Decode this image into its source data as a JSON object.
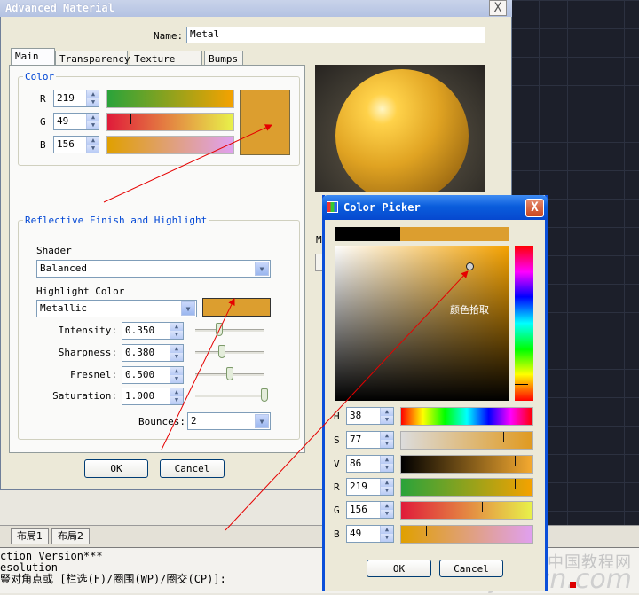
{
  "advanced_material": {
    "title": "Advanced Material",
    "close_glyph": "X",
    "name_label": "Name:",
    "name_value": "Metal",
    "tabs": [
      "Main",
      "Transparency",
      "Texture Maps",
      "Bumps"
    ],
    "color_group": "Color",
    "color_channels": [
      {
        "label": "R",
        "value": "219",
        "level": 0.86,
        "gradient": [
          "#2aa33a",
          "#f5a200"
        ]
      },
      {
        "label": "G",
        "value": "49",
        "level": 0.19,
        "gradient": [
          "#e01b3a",
          "#e8f24a"
        ]
      },
      {
        "label": "B",
        "value": "156",
        "level": 0.61,
        "gradient": [
          "#e0a000",
          "#e0a0f0"
        ]
      }
    ],
    "color_swatch": "#dc9e2f",
    "reflective_group": "Reflective Finish and Highlight",
    "shader_label": "Shader",
    "shader_value": "Balanced",
    "highlight_color_label": "Highlight Color",
    "highlight_color_value": "Metallic",
    "highlight_swatch": "#dc9e2f",
    "params": [
      {
        "label": "Intensity:",
        "value": "0.350",
        "level": 0.35
      },
      {
        "label": "Sharpness:",
        "value": "0.380",
        "level": 0.38
      },
      {
        "label": "Fresnel:",
        "value": "0.500",
        "level": 0.5
      },
      {
        "label": "Saturation:",
        "value": "1.000",
        "level": 1.0
      }
    ],
    "bounces_label": "Bounces:",
    "bounces_value": "2",
    "ok_label": "OK",
    "cancel_label": "Cancel",
    "preview_clip_label": "M"
  },
  "color_picker": {
    "title": "Color Picker",
    "close_glyph": "X",
    "old_color": "#000000",
    "new_color": "#dc9e2f",
    "picker_note": "颜色拾取",
    "channels": [
      {
        "label": "H",
        "value": "38",
        "level": 0.1
      },
      {
        "label": "S",
        "value": "77",
        "level": 0.77
      },
      {
        "label": "V",
        "value": "86",
        "level": 0.86
      },
      {
        "label": "R",
        "value": "219",
        "level": 0.86
      },
      {
        "label": "G",
        "value": "156",
        "level": 0.61
      },
      {
        "label": "B",
        "value": "49",
        "level": 0.19
      }
    ],
    "ok_label": "OK",
    "cancel_label": "Cancel"
  },
  "cad": {
    "layout_tabs": [
      "布局1",
      "布局2"
    ],
    "command_lines": [
      "ction Version***",
      "esolution",
      "豎对角点或 [栏选(F)/圈围(WP)/圈交(CP)]:"
    ]
  },
  "watermark": {
    "cn": "中国教程网",
    "en": "jcwcn.com"
  }
}
